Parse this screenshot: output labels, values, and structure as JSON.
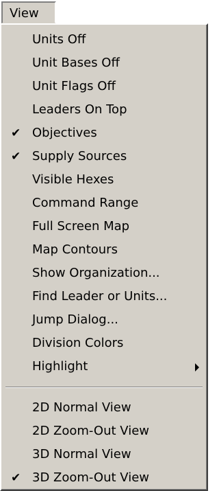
{
  "menubar": {
    "label": "View"
  },
  "menu": {
    "items": [
      {
        "label": "Units Off",
        "checked": false
      },
      {
        "label": "Unit Bases Off",
        "checked": false
      },
      {
        "label": "Unit Flags Off",
        "checked": false
      },
      {
        "label": "Leaders On Top",
        "checked": false
      },
      {
        "label": "Objectives",
        "checked": true
      },
      {
        "label": "Supply Sources",
        "checked": true
      },
      {
        "label": "Visible Hexes",
        "checked": false
      },
      {
        "label": "Command Range",
        "checked": false
      },
      {
        "label": "Full Screen Map",
        "checked": false
      },
      {
        "label": "Map Contours",
        "checked": false
      },
      {
        "label": "Show Organization...",
        "checked": false
      },
      {
        "label": "Find Leader or Units...",
        "checked": false
      },
      {
        "label": "Jump Dialog...",
        "checked": false
      },
      {
        "label": "Division Colors",
        "checked": false
      },
      {
        "label": "Highlight",
        "checked": false,
        "submenu": true
      },
      {
        "label": "2D Normal View",
        "checked": false
      },
      {
        "label": "2D Zoom-Out View",
        "checked": false
      },
      {
        "label": "3D Normal View",
        "checked": false
      },
      {
        "label": "3D Zoom-Out View",
        "checked": true
      }
    ],
    "check_glyph": "✔"
  }
}
